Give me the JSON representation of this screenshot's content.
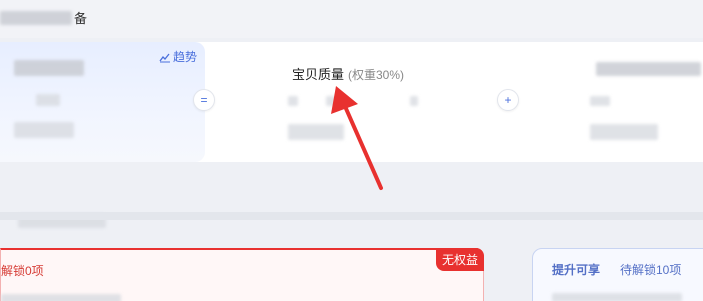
{
  "header": {
    "title_suffix": "备"
  },
  "metrics": {
    "trend_label": "趋势",
    "op_equal": "=",
    "op_plus": "+",
    "quality_title": "宝贝质量",
    "quality_weight": "(权重30%)"
  },
  "alert": {
    "text": "解锁0项",
    "badge": "无权益"
  },
  "promo": {
    "title": "提升可享",
    "subtitle": "待解锁10项"
  },
  "colors": {
    "accent": "#4a6fdc",
    "danger": "#e8312f",
    "promo": "#5470c6"
  }
}
